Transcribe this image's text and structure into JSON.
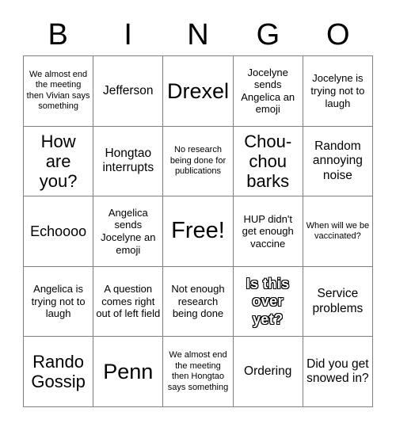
{
  "card": {
    "title": "BINGO",
    "header_letters": [
      "B",
      "I",
      "N",
      "G",
      "O"
    ],
    "grid_size": "5x5",
    "colors": {
      "background": "#ffffff",
      "text": "#000000",
      "grid_line": "#808080"
    },
    "cells": [
      [
        {
          "text": "We almost end the meeting then Vivian says something",
          "size": "xs",
          "style": "normal"
        },
        {
          "text": "Jefferson",
          "size": "m",
          "style": "normal"
        },
        {
          "text": "Drexel",
          "size": "xxl",
          "style": "normal"
        },
        {
          "text": "Jocelyne sends Angelica an emoji",
          "size": "s",
          "style": "normal"
        },
        {
          "text": "Jocelyne is trying not to laugh",
          "size": "s",
          "style": "normal"
        }
      ],
      [
        {
          "text": "How are you?",
          "size": "xl",
          "style": "normal"
        },
        {
          "text": "Hongtao interrupts",
          "size": "m",
          "style": "normal"
        },
        {
          "text": "No research being done for publications",
          "size": "xs",
          "style": "normal"
        },
        {
          "text": "Chou-chou barks",
          "size": "xl",
          "style": "normal"
        },
        {
          "text": "Random annoying noise",
          "size": "m",
          "style": "normal"
        }
      ],
      [
        {
          "text": "Echoooo",
          "size": "l",
          "style": "normal"
        },
        {
          "text": "Angelica sends Jocelyne an emoji",
          "size": "s",
          "style": "normal"
        },
        {
          "text": "Free!",
          "size": "free",
          "style": "normal"
        },
        {
          "text": "HUP didn't get enough vaccine",
          "size": "s",
          "style": "normal"
        },
        {
          "text": "When will we be vaccinated?",
          "size": "xs",
          "style": "normal"
        }
      ],
      [
        {
          "text": "Angelica is trying not to laugh",
          "size": "s",
          "style": "normal"
        },
        {
          "text": "A question comes right out of left field",
          "size": "s",
          "style": "normal"
        },
        {
          "text": "Not enough research being done",
          "size": "s",
          "style": "normal"
        },
        {
          "text": "Is this over yet?",
          "size": "l",
          "style": "outline"
        },
        {
          "text": "Service problems",
          "size": "m",
          "style": "normal"
        }
      ],
      [
        {
          "text": "Rando Gossip",
          "size": "xl",
          "style": "normal"
        },
        {
          "text": "Penn",
          "size": "xxl",
          "style": "normal"
        },
        {
          "text": "We almost end the meeting then Hongtao says something",
          "size": "xs",
          "style": "normal"
        },
        {
          "text": "Ordering",
          "size": "m",
          "style": "normal"
        },
        {
          "text": "Did you get snowed in?",
          "size": "m",
          "style": "normal"
        }
      ]
    ]
  }
}
